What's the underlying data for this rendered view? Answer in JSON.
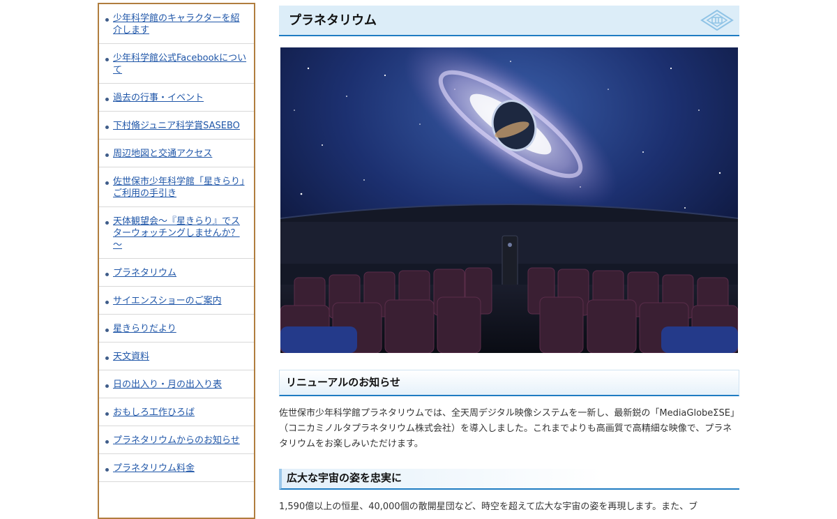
{
  "sidebar": {
    "items": [
      {
        "label": "少年科学館のキャラクターを紹介します"
      },
      {
        "label": "少年科学館公式Facebookについて"
      },
      {
        "label": "過去の行事・イベント"
      },
      {
        "label": "下村脩ジュニア科学賞SASEBO"
      },
      {
        "label": "周辺地図と交通アクセス"
      },
      {
        "label": "佐世保市少年科学館「星きらり」ご利用の手引き"
      },
      {
        "label": "天体観望会～『星きらり』でスターウォッチングしませんか？～"
      },
      {
        "label": "プラネタリウム"
      },
      {
        "label": "サイエンスショーのご案内"
      },
      {
        "label": "星きらりだより"
      },
      {
        "label": "天文資料"
      },
      {
        "label": "日の出入り・月の出入り表"
      },
      {
        "label": "おもしろ工作ひろば"
      },
      {
        "label": "プラネタリウムからのお知らせ"
      },
      {
        "label": "プラネタリウム料金"
      }
    ]
  },
  "page": {
    "title": "プラネタリウム",
    "emblem_icon": "sasebo-city-emblem-icon"
  },
  "hero": {
    "description_icon": "planetarium-dome-photo"
  },
  "section1": {
    "heading": "リニューアルのお知らせ",
    "paragraph": "佐世保市少年科学館プラネタリウムでは、全天周デジタル映像システムを一新し、最新鋭の「MediaGlobeΣSE」（コニカミノルタプラネタリウム株式会社）を導入しました。これまでよりも高画質で高精細な映像で、プラネタリウムをお楽しみいただけます。"
  },
  "section2": {
    "heading": "広大な宇宙の姿を忠実に",
    "paragraph": "1,590億以上の恒星、40,000個の散開星団など、時空を超えて広大な宇宙の姿を再現します。また、ブ"
  },
  "colors": {
    "sidebar_border": "#b07d3e",
    "link": "#1f56a8",
    "accent_blue": "#1f7cc2",
    "heading_bg": "#dcedf8"
  }
}
